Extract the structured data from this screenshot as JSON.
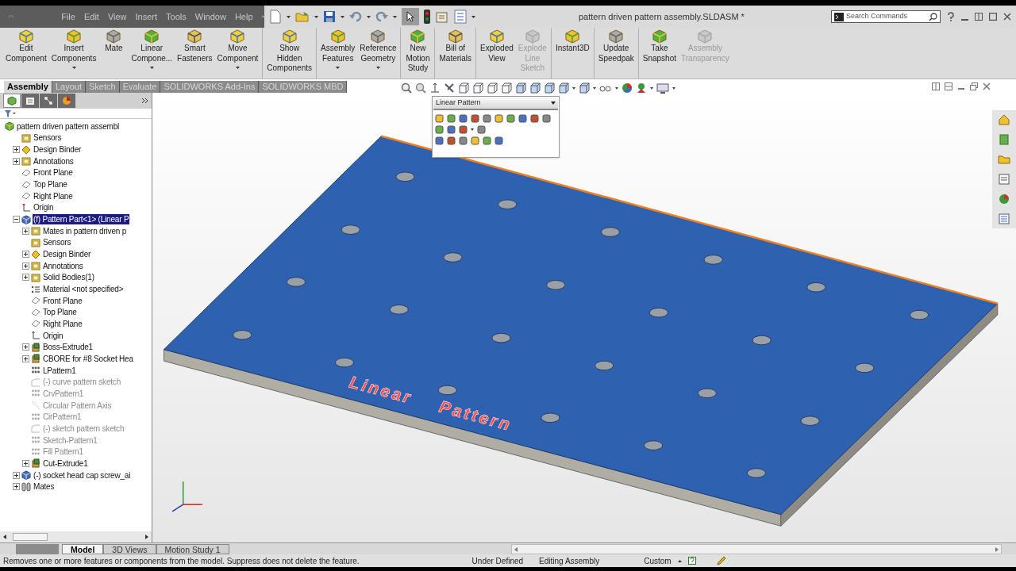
{
  "window": {
    "title": "pattern driven pattern assembly.SLDASM *"
  },
  "menu": [
    "File",
    "Edit",
    "View",
    "Insert",
    "Tools",
    "Window",
    "Help"
  ],
  "search": {
    "placeholder": "Search Commands"
  },
  "ribbon": [
    [
      {
        "label": "Edit\nComponent",
        "dropdown": false,
        "disabled": false
      },
      {
        "label": "Insert\nComponents",
        "dropdown": true,
        "disabled": false
      },
      {
        "label": "Mate",
        "dropdown": false,
        "disabled": false
      },
      {
        "label": "Linear\nCompone...",
        "dropdown": true,
        "disabled": false
      },
      {
        "label": "Smart\nFasteners",
        "dropdown": false,
        "disabled": false
      },
      {
        "label": "Move\nComponent",
        "dropdown": true,
        "disabled": false
      }
    ],
    [
      {
        "label": "Show\nHidden\nComponents",
        "dropdown": false,
        "disabled": false
      }
    ],
    [
      {
        "label": "Assembly\nFeatures",
        "dropdown": true,
        "disabled": false
      },
      {
        "label": "Reference\nGeometry",
        "dropdown": true,
        "disabled": false
      }
    ],
    [
      {
        "label": "New\nMotion\nStudy",
        "dropdown": false,
        "disabled": false
      }
    ],
    [
      {
        "label": "Bill of\nMaterials",
        "dropdown": false,
        "disabled": false
      }
    ],
    [
      {
        "label": "Exploded\nView",
        "dropdown": false,
        "disabled": false
      },
      {
        "label": "Explode\nLine\nSketch",
        "dropdown": false,
        "disabled": true
      }
    ],
    [
      {
        "label": "Instant3D",
        "dropdown": false,
        "disabled": false
      }
    ],
    [
      {
        "label": "Update\nSpeedpak",
        "dropdown": false,
        "disabled": false
      }
    ],
    [
      {
        "label": "Take\nSnapshot",
        "dropdown": false,
        "disabled": false
      },
      {
        "label": "Assembly\nTransparency",
        "dropdown": false,
        "disabled": true
      }
    ]
  ],
  "tabs": [
    {
      "label": "Assembly",
      "selected": true
    },
    {
      "label": "Layout",
      "selected": false
    },
    {
      "label": "Sketch",
      "selected": false
    },
    {
      "label": "Evaluate",
      "selected": false
    },
    {
      "label": "SOLIDWORKS Add-Ins",
      "selected": false
    },
    {
      "label": "SOLIDWORKS MBD",
      "selected": false
    }
  ],
  "tree": [
    {
      "label": "pattern driven pattern assembl",
      "kind": "assembly",
      "selected": false,
      "suppressed": false,
      "children": [
        {
          "label": "Sensors",
          "kind": "folder",
          "selected": false,
          "suppressed": false
        },
        {
          "label": "Design Binder",
          "kind": "binder",
          "expanded": false,
          "selected": false,
          "suppressed": false
        },
        {
          "label": "Annotations",
          "kind": "folder",
          "expanded": false,
          "selected": false,
          "suppressed": false
        },
        {
          "label": "Front Plane",
          "kind": "plane",
          "selected": false,
          "suppressed": false
        },
        {
          "label": "Top Plane",
          "kind": "plane",
          "selected": false,
          "suppressed": false
        },
        {
          "label": "Right Plane",
          "kind": "plane",
          "selected": false,
          "suppressed": false
        },
        {
          "label": "Origin",
          "kind": "origin",
          "selected": false,
          "suppressed": false
        },
        {
          "label": "(f) Pattern Part<1> (Linear P",
          "kind": "part",
          "expanded": true,
          "selected": true,
          "suppressed": false,
          "children": [
            {
              "label": "Mates in pattern driven p",
              "kind": "folder",
              "expanded": false,
              "selected": false,
              "suppressed": false
            },
            {
              "label": "Sensors",
              "kind": "folder",
              "selected": false,
              "suppressed": false
            },
            {
              "label": "Design Binder",
              "kind": "binder",
              "expanded": false,
              "selected": false,
              "suppressed": false
            },
            {
              "label": "Annotations",
              "kind": "folder",
              "expanded": false,
              "selected": false,
              "suppressed": false
            },
            {
              "label": "Solid Bodies(1)",
              "kind": "folder",
              "expanded": false,
              "selected": false,
              "suppressed": false
            },
            {
              "label": "Material <not specified>",
              "kind": "material",
              "selected": false,
              "suppressed": false
            },
            {
              "label": "Front Plane",
              "kind": "plane",
              "selected": false,
              "suppressed": false
            },
            {
              "label": "Top Plane",
              "kind": "plane",
              "selected": false,
              "suppressed": false
            },
            {
              "label": "Right Plane",
              "kind": "plane",
              "selected": false,
              "suppressed": false
            },
            {
              "label": "Origin",
              "kind": "origin",
              "selected": false,
              "suppressed": false
            },
            {
              "label": "Boss-Extrude1",
              "kind": "feature",
              "expanded": false,
              "selected": false,
              "suppressed": false
            },
            {
              "label": "CBORE for #8 Socket Hea",
              "kind": "feature",
              "expanded": false,
              "selected": false,
              "suppressed": false
            },
            {
              "label": "LPattern1",
              "kind": "pattern",
              "selected": false,
              "suppressed": false
            },
            {
              "label": "(-) curve pattern sketch",
              "kind": "sketch",
              "selected": false,
              "suppressed": true
            },
            {
              "label": "CrvPattern1",
              "kind": "pattern",
              "selected": false,
              "suppressed": true
            },
            {
              "label": "Circular Pattern Axis",
              "kind": "axis",
              "selected": false,
              "suppressed": true
            },
            {
              "label": "CirPattern1",
              "kind": "pattern",
              "selected": false,
              "suppressed": true
            },
            {
              "label": "(-) sketch pattern sketch",
              "kind": "sketch",
              "selected": false,
              "suppressed": true
            },
            {
              "label": "Sketch-Pattern1",
              "kind": "pattern",
              "selected": false,
              "suppressed": true
            },
            {
              "label": "Fill Pattern1",
              "kind": "pattern",
              "selected": false,
              "suppressed": true
            },
            {
              "label": "Cut-Extrude1",
              "kind": "feature",
              "expanded": false,
              "selected": false,
              "suppressed": false
            }
          ]
        },
        {
          "label": "(-) socket head cap screw_ai",
          "kind": "part",
          "expanded": false,
          "selected": false,
          "suppressed": false
        },
        {
          "label": "Mates",
          "kind": "mates",
          "expanded": false,
          "selected": false,
          "suppressed": false
        }
      ]
    }
  ],
  "context_toolbar": {
    "title": "Linear Pattern"
  },
  "viewport": {
    "model_label_words": [
      "Linear",
      "Pattern"
    ]
  },
  "bottom_tabs": [
    {
      "label": "Model",
      "selected": true
    },
    {
      "label": "3D Views",
      "selected": false
    },
    {
      "label": "Motion Study 1",
      "selected": false
    }
  ],
  "status_bar": {
    "message": "Removes one or more features or components from the model. Suppress does not delete the feature.",
    "fields": [
      "Under Defined",
      "Editing Assembly",
      "Custom"
    ]
  }
}
